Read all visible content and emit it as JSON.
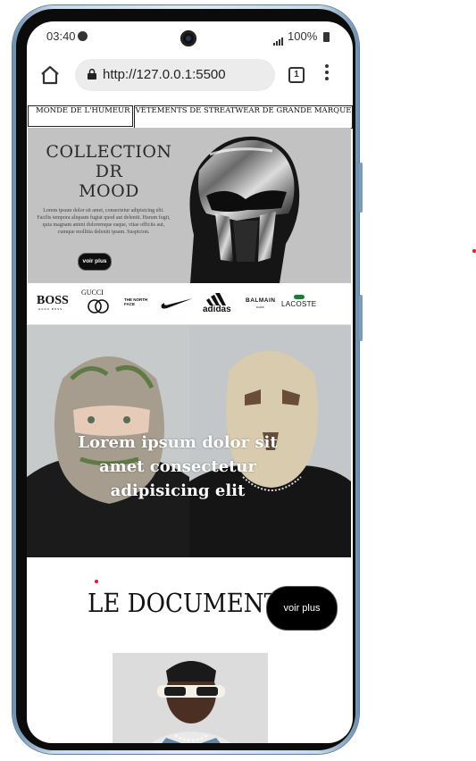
{
  "status_bar": {
    "time": "03:40",
    "battery": "100%"
  },
  "browser": {
    "url": "http://127.0.0.1:5500",
    "tab_count": "1"
  },
  "nav": {
    "left": "MONDE DE L'HUMEUR",
    "right": "VÊTEMENTS DE STREATWEAR DE GRANDE MARQUE"
  },
  "hero": {
    "title_line1": "COLLECTION DR",
    "title_line2": "MOOD",
    "text": "Lorem ipsum dolor sit amet, consectetur adipisicing elit. Facilis tempora aliquam fugiat quod aut deleniti. Harum fugit, quia magnam animi doloremque eaque, vitae officiis aut, cumque mollitia deleniti ipsam. Suspicion.",
    "button": "voir plus"
  },
  "brands": [
    "BOSS",
    "HUGO BOSS",
    "GUCCI",
    "THE NORTH FACE",
    "NIKE",
    "adidas",
    "BALMAIN",
    "PARIS",
    "LACOSTE"
  ],
  "banner": {
    "text": "Lorem ipsum dolor sit amet consectetur adipisicing elit"
  },
  "section": {
    "title": "LE DOCUMENT",
    "button": "voir plus"
  },
  "colors": {
    "accent": "#000000",
    "hero_bg": "#c2c2c2",
    "frame": "#8fb0cf"
  }
}
